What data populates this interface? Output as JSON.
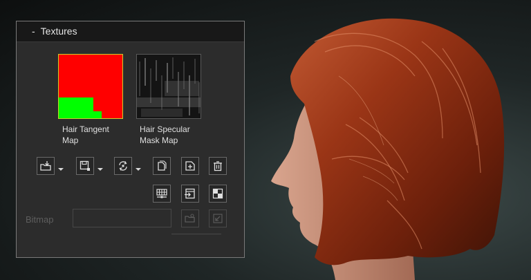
{
  "panel": {
    "title": "Textures",
    "collapse_symbol": "-",
    "thumbnails": [
      {
        "label_line1": "Hair Tangent",
        "label_line2": "Map"
      },
      {
        "label_line1": "Hair Specular",
        "label_line2": "Mask Map"
      }
    ],
    "toolbar_row1": [
      {
        "icon": "load-icon",
        "has_dropdown": true
      },
      {
        "icon": "save-icon",
        "has_dropdown": true
      },
      {
        "icon": "refresh-icon",
        "has_dropdown": true
      },
      {
        "icon": "copy-icon",
        "has_dropdown": false
      },
      {
        "icon": "add-layer-icon",
        "has_dropdown": false
      },
      {
        "icon": "delete-icon",
        "has_dropdown": false
      }
    ],
    "toolbar_row2": [
      {
        "icon": "uv-grid-icon"
      },
      {
        "icon": "import-icon"
      },
      {
        "icon": "checker-icon"
      }
    ],
    "bitmap": {
      "label": "Bitmap",
      "value": "",
      "placeholder": ""
    }
  },
  "colors": {
    "panel_bg": "#2c2c2c",
    "header_bg": "#181818",
    "tangent_red": "#ff0000",
    "tangent_green": "#00ff00",
    "hair_color": "#8a2d12"
  }
}
